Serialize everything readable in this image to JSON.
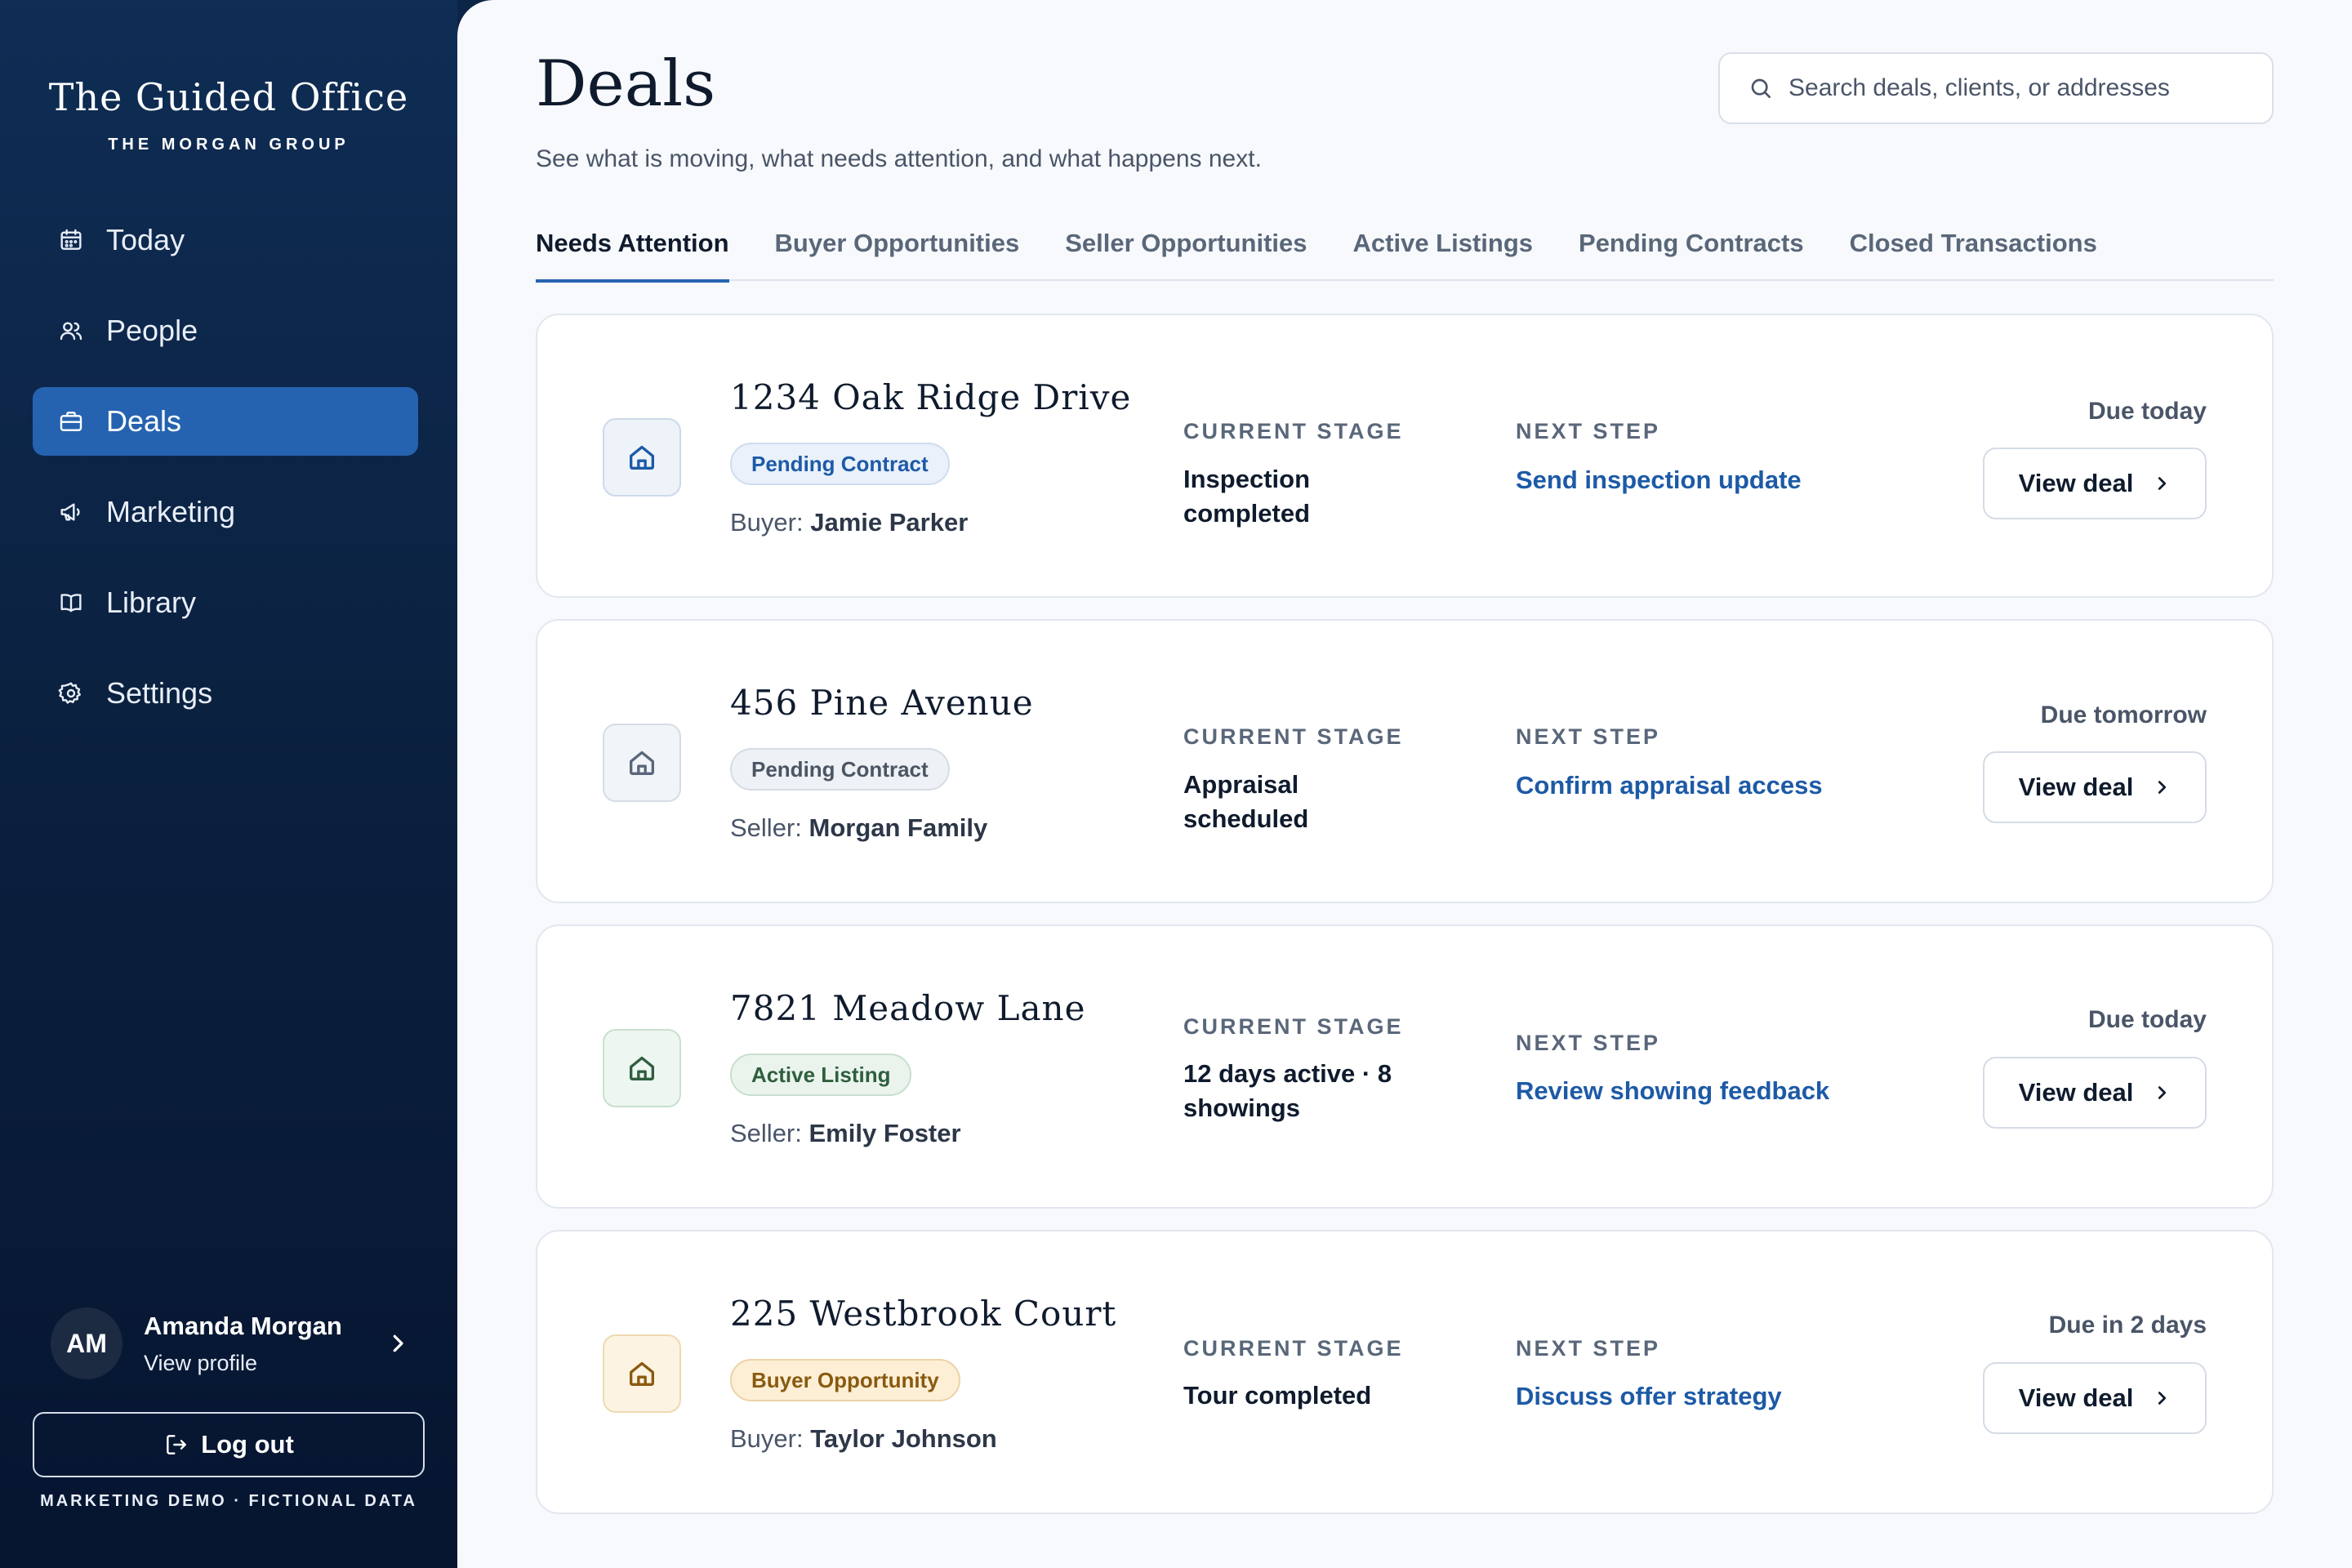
{
  "sidebar": {
    "brand_title": "The Guided Office",
    "brand_subtitle": "THE MORGAN GROUP",
    "nav": [
      {
        "label": "Today",
        "icon": "calendar-icon"
      },
      {
        "label": "People",
        "icon": "people-icon"
      },
      {
        "label": "Deals",
        "icon": "briefcase-icon",
        "active": true
      },
      {
        "label": "Marketing",
        "icon": "megaphone-icon"
      },
      {
        "label": "Library",
        "icon": "book-icon"
      },
      {
        "label": "Settings",
        "icon": "gear-icon"
      }
    ],
    "profile": {
      "initials": "AM",
      "name": "Amanda Morgan",
      "link": "View profile"
    },
    "logout_label": "Log out",
    "footer_note": "MARKETING DEMO · FICTIONAL DATA"
  },
  "header": {
    "title": "Deals",
    "subtitle": "See what is moving, what needs attention, and what happens next.",
    "search_placeholder": "Search deals, clients, or addresses"
  },
  "tabs": [
    {
      "label": "Needs Attention",
      "active": true
    },
    {
      "label": "Buyer Opportunities"
    },
    {
      "label": "Seller Opportunities"
    },
    {
      "label": "Active Listings"
    },
    {
      "label": "Pending Contracts"
    },
    {
      "label": "Closed Transactions"
    }
  ],
  "labels": {
    "current_stage": "CURRENT STAGE",
    "next_step": "NEXT STEP",
    "view_deal": "View deal"
  },
  "deals": [
    {
      "address": "1234 Oak Ridge Drive",
      "badge": "Pending Contract",
      "party_role": "Buyer:",
      "party_name": "Jamie Parker",
      "current_stage": "Inspection completed",
      "next_step": "Send inspection update",
      "due": "Due today"
    },
    {
      "address": "456 Pine Avenue",
      "badge": "Pending Contract",
      "party_role": "Seller:",
      "party_name": "Morgan Family",
      "current_stage": "Appraisal scheduled",
      "next_step": "Confirm appraisal access",
      "due": "Due tomorrow"
    },
    {
      "address": "7821 Meadow Lane",
      "badge": "Active Listing",
      "party_role": "Seller:",
      "party_name": "Emily Foster",
      "current_stage": "12 days active · 8 showings",
      "next_step": "Review showing feedback",
      "due": "Due today"
    },
    {
      "address": "225 Westbrook Court",
      "badge": "Buyer Opportunity",
      "party_role": "Buyer:",
      "party_name": "Taylor Johnson",
      "current_stage": "Tour completed",
      "next_step": "Discuss offer strategy",
      "due": "Due in 2 days"
    }
  ],
  "colors": {
    "accent": "#2563b0",
    "link": "#1d5aa6",
    "sidebar_bg": "#0b2140",
    "main_bg": "#f7f9fc"
  }
}
